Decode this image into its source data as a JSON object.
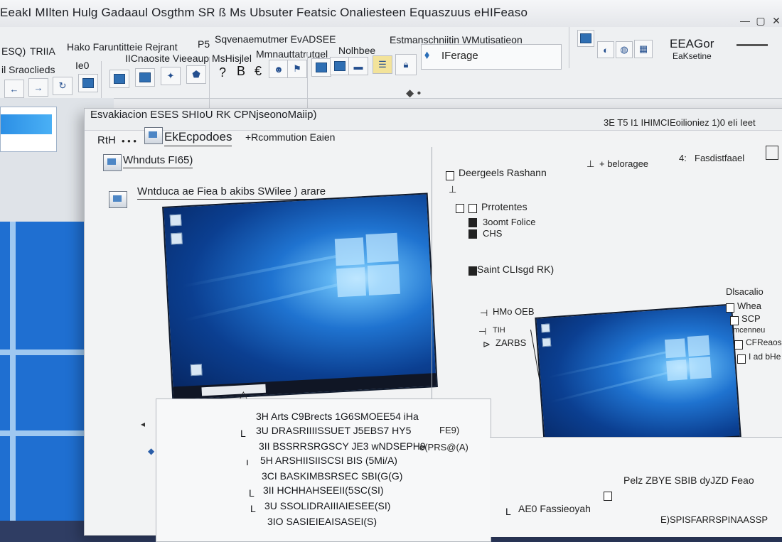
{
  "window": {
    "title": "EeakI MIlten Hulg Gadaaul Osgthm SR ß Ms Ubsuter Featsic Onaliesteen Equaszuus eHIFeaso"
  },
  "ribbon": {
    "row1": [
      "ESQ)",
      "TRIIA",
      "Hako Faruntitteie Rejrant",
      "P5",
      "Sqvenaemutmer EvADSEE"
    ],
    "row1_right": [
      "Estmanschniitin WMutisatieon"
    ],
    "row2": [
      "il Sraoclieds",
      "Ie0",
      "IICnaosite Vieeaup MsHisjlel",
      "Mmnauttatrutgel",
      "Nolhbee",
      "IFerage"
    ],
    "group_right_title": "EEAGor",
    "group_right_sub": "EaKsetine",
    "icon_glyphs": [
      "?",
      "B",
      "€"
    ]
  },
  "dialog": {
    "title": "Esvakiacion ESES SHIoU RK CPNjseonoMaiip)",
    "path_prefix": "RtH",
    "path_link": "EkEcpodoes",
    "path_suffix": "+Rcommution Eaien",
    "item1": "Whnduts FI65)",
    "item2": "Wntduca ae Fiea b akibs SWilee ) arare",
    "right_header": "3E T5 I1 IHIMCIEoilioniez 1)0 eIi Ieet",
    "opt_designs": "Deergeels Rashann",
    "opt_properties": "Prrotentes",
    "opt_scope1": "3oomt Folice",
    "opt_scope2": "CHS",
    "opt_saint": "Saint CLIsgd RK)",
    "tool_label1": "+ beloragee",
    "tool_label2": "Fasdistfaael",
    "dim_label1": "HMo OEB",
    "dim_label2": "TIH",
    "dim_label3": "ZARBS",
    "side_options": [
      "Dlsacalio",
      "Whea",
      "SCP",
      "mcenneu",
      "CFReaos",
      "I ad bHe"
    ],
    "list_rows": [
      "3H Arts C9Brects 1G6SMOEE54 iHa",
      "3U DRASRIIIISSUET J5EBS7 HY5",
      "3II BSSRRSRGSCY JE3 wNDSEPH9",
      "5H ARSHIISIISCSI BIS (5Mi/A)",
      "3CI BASKIMBSRSEC SBI(G(G)",
      "3II HCHHAHSEEII(5SC(SI)",
      "3U SSOLIDRAIIIAIESEE(SI)",
      "3IO SASIEIEAISASEI(S)"
    ],
    "list_side_labels": [
      "FE9)",
      "e(PRS@(A)"
    ],
    "bottom_right": "Pelz ZBYE SBIB dyJZD Feao",
    "bottom_right2": "AE0 Fassieoyah",
    "bottom_right3": "E)SPISFARRSPINAASSP"
  },
  "colors": {
    "accent_blue": "#1f6fd1",
    "wallpaper_dark": "#06235c",
    "dialog_bg": "#f2f3f4",
    "titlebar_bg": "#e4e6ea"
  }
}
